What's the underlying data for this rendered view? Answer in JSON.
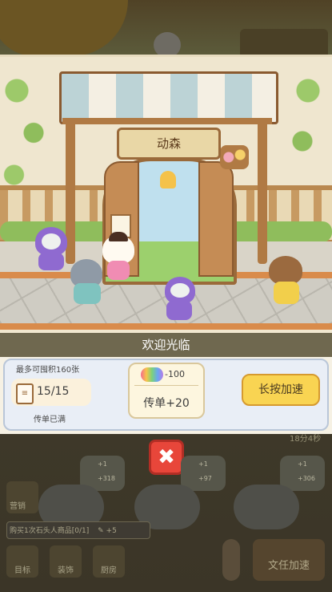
{
  "scene": {
    "shop_sign": "动森"
  },
  "welcome_panel": {
    "title": "欢迎光临",
    "max_flyers_label": "最多可囤积160张",
    "flyer_count": "15/15",
    "flyer_status": "传单已满",
    "flyer_cost": "-100",
    "flyer_reward": "传单+20",
    "hold_accelerate_label": "长按加速"
  },
  "close_button": {
    "glyph": "✖"
  },
  "background_ui": {
    "timer": "18分4秒",
    "bubbles": [
      {
        "top": "+1",
        "bottom": "+318"
      },
      {
        "top": "+1",
        "bottom": "+97"
      },
      {
        "top": "+1",
        "bottom": "+306"
      }
    ],
    "marketing_label": "营销",
    "ticker_text": "购买1次石头人商品[0/1]",
    "ticker_reward": "+5",
    "nav": [
      "目标",
      "装饰",
      "厨房"
    ],
    "task_accelerate_label": "文任加速"
  },
  "colors": {
    "panel_title_bg": "#6f684f",
    "hold_button": "#f9d452",
    "close_button": "#e8463a"
  }
}
